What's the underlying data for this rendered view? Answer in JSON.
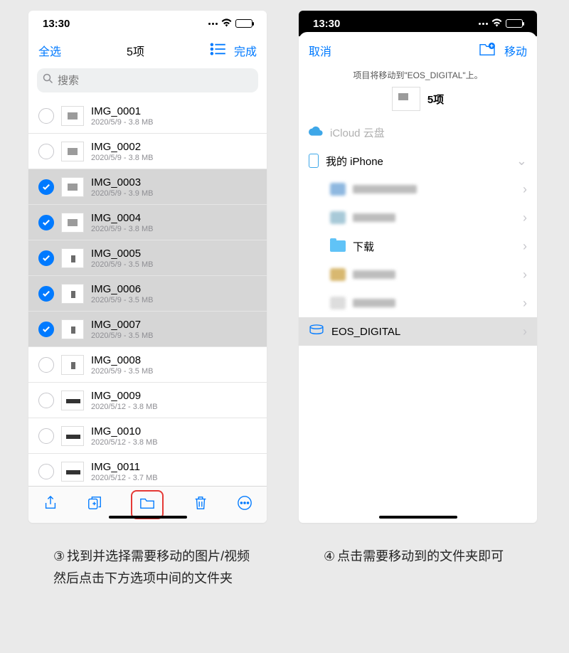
{
  "status": {
    "time": "13:30"
  },
  "left": {
    "nav": {
      "select_all": "全选",
      "title": "5项",
      "done": "完成"
    },
    "search": {
      "placeholder": "搜索"
    },
    "files": [
      {
        "name": "IMG_0001",
        "meta": "2020/5/9 - 3.8 MB",
        "selected": false,
        "thumb": "v1"
      },
      {
        "name": "IMG_0002",
        "meta": "2020/5/9 - 3.8 MB",
        "selected": false,
        "thumb": "v1"
      },
      {
        "name": "IMG_0003",
        "meta": "2020/5/9 - 3.9 MB",
        "selected": true,
        "thumb": "v1"
      },
      {
        "name": "IMG_0004",
        "meta": "2020/5/9 - 3.8 MB",
        "selected": true,
        "thumb": "v1"
      },
      {
        "name": "IMG_0005",
        "meta": "2020/5/9 - 3.5 MB",
        "selected": true,
        "thumb": "v2"
      },
      {
        "name": "IMG_0006",
        "meta": "2020/5/9 - 3.5 MB",
        "selected": true,
        "thumb": "v2"
      },
      {
        "name": "IMG_0007",
        "meta": "2020/5/9 - 3.5 MB",
        "selected": true,
        "thumb": "v2"
      },
      {
        "name": "IMG_0008",
        "meta": "2020/5/9 - 3.5 MB",
        "selected": false,
        "thumb": "v2"
      },
      {
        "name": "IMG_0009",
        "meta": "2020/5/12 - 3.8 MB",
        "selected": false,
        "thumb": "v3"
      },
      {
        "name": "IMG_0010",
        "meta": "2020/5/12 - 3.8 MB",
        "selected": false,
        "thumb": "v3"
      },
      {
        "name": "IMG_0011",
        "meta": "2020/5/12 - 3.7 MB",
        "selected": false,
        "thumb": "v3"
      }
    ]
  },
  "right": {
    "nav": {
      "cancel": "取消",
      "move": "移动"
    },
    "info": "项目将移动到\"EOS_DIGITAL\"上。",
    "count": "5项",
    "icloud": "iCloud 云盘",
    "myiphone": "我的 iPhone",
    "downloads": "下载",
    "eos": "EOS_DIGITAL"
  },
  "captions": {
    "step3_num": "③",
    "step3": "找到并选择需要移动的图片/视频然后点击下方选项中间的文件夹",
    "step4_num": "④",
    "step4": "点击需要移动到的文件夹即可"
  }
}
